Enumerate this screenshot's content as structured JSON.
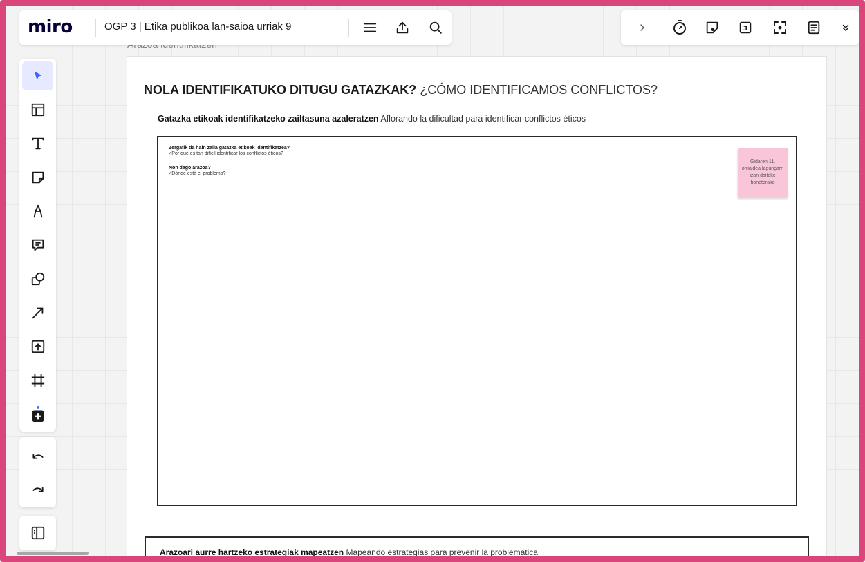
{
  "app": {
    "logo": "miro",
    "board_name": "OGP 3 | Etika publikoa lan-saioa urriak 9"
  },
  "topbar_left_icons": [
    "menu-icon",
    "upload-icon",
    "search-icon"
  ],
  "topbar_right_icons": [
    "chevron-right-icon",
    "timer-icon",
    "sticker-icon",
    "vote-icon",
    "focus-icon",
    "notes-icon",
    "chevron-double-down-icon"
  ],
  "toolbar": {
    "tools": [
      "select-cursor-icon",
      "templates-icon",
      "text-icon",
      "sticky-note-icon",
      "pen-icon",
      "comment-icon",
      "shapes-icon",
      "connector-arrow-icon",
      "upload-icon",
      "frame-icon",
      "more-apps-icon"
    ],
    "active": "select-cursor-icon"
  },
  "board": {
    "caption": "Arazoa identifikatzen",
    "title_bold": "NOLA IDENTIFIKATUKO DITUGU GATAZKAK?",
    "title_regular": "¿CÓMO IDENTIFICAMOS CONFLICTOS?",
    "subtitle_bold": "Gatazka etikoak identifikatzeko zailtasuna azaleratzen",
    "subtitle_regular": "Aflorando la dificultad para identificar conflictos éticos",
    "questions": [
      {
        "bold": "Zergatik da hain zaila gatazka etikoak identifikatzea?",
        "regular": "¿Por qué es tan difícil identificar los conflictos éticos?"
      },
      {
        "bold": "Non dago arazoa?",
        "regular": "¿Dónde está el problema?"
      }
    ],
    "sticky_note": {
      "text": "Gidaren 11. orrialdea lagungarri izan daiteke honeterako",
      "color": "#f9c6d9"
    },
    "next_frame_bold": "Arazoari aurre hartzeko estrategiak mapeatzen",
    "next_frame_regular": "Mapeando estrategias para prevenir la problemática"
  },
  "colors": {
    "screenshot_border": "#d8467c",
    "accent_active": "#4262ff",
    "logo": "#050038"
  }
}
